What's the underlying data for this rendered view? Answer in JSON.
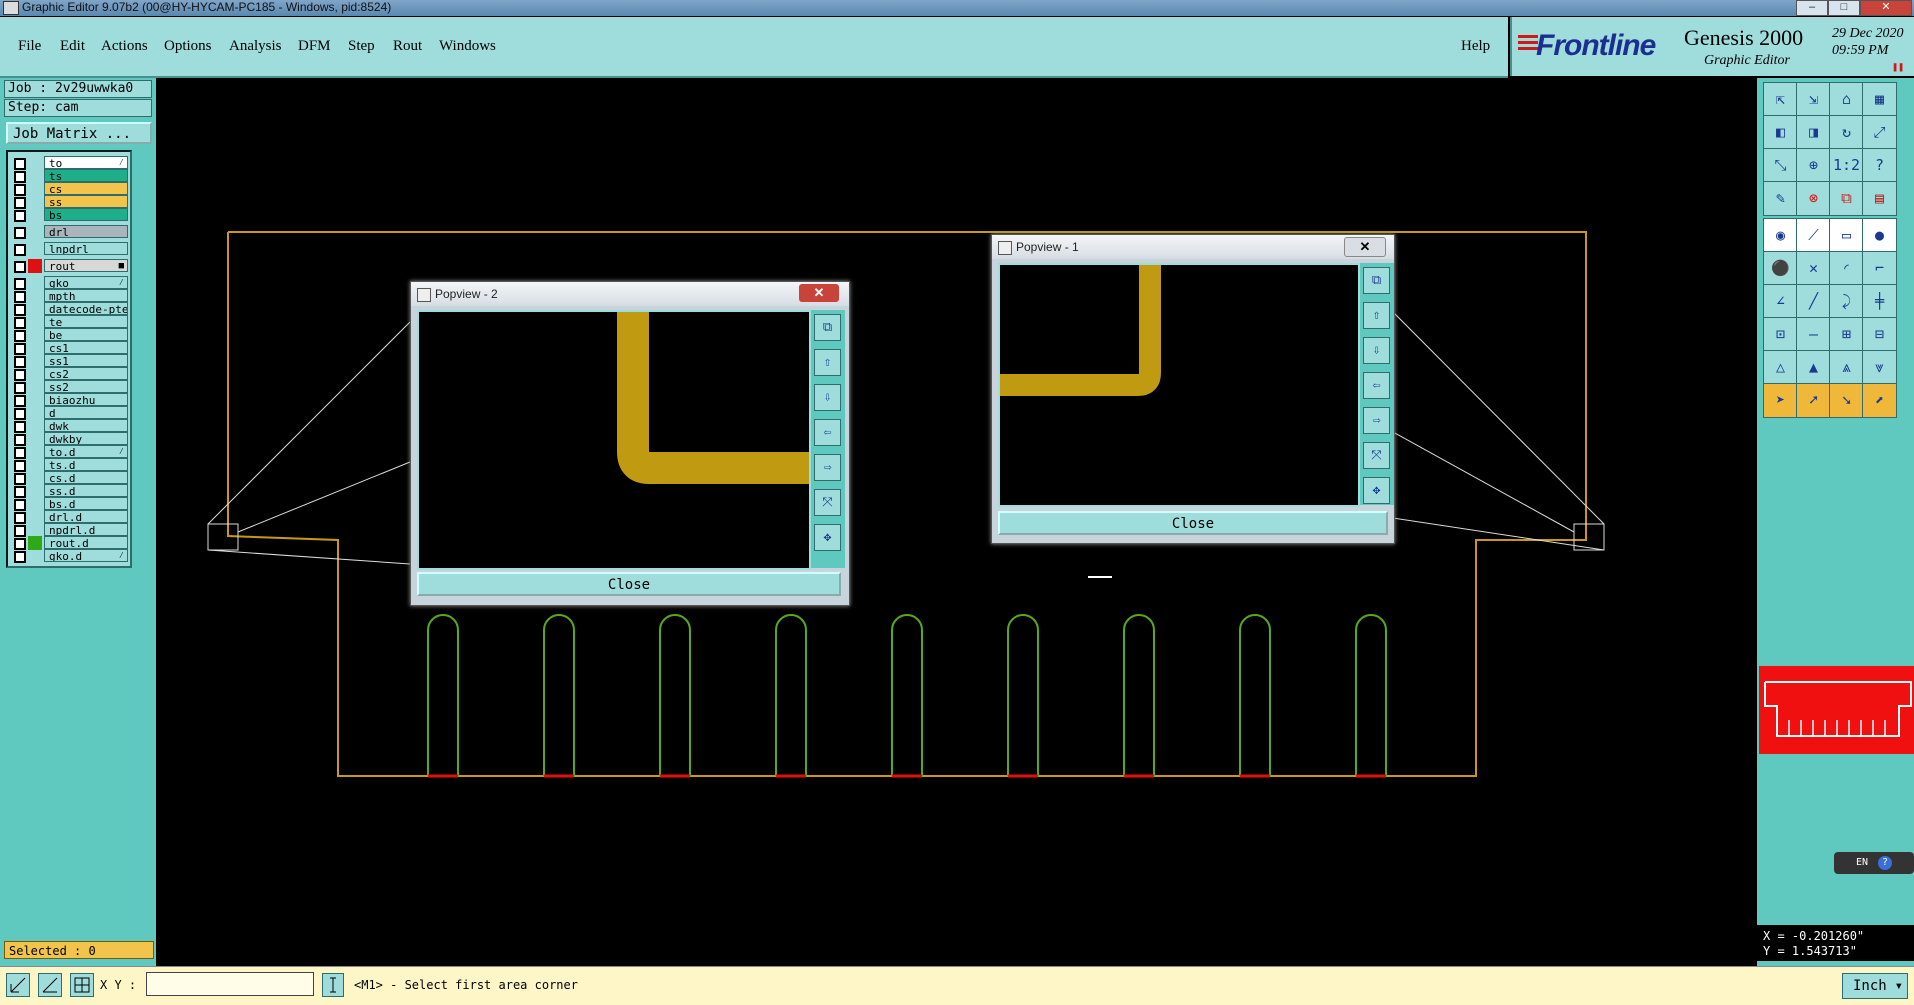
{
  "window": {
    "title": "Graphic Editor 9.07b2 (00@HY-HYCAM-PC185 - Windows, pid:8524)"
  },
  "menu": {
    "items": [
      "File",
      "Edit",
      "Actions",
      "Options",
      "Analysis",
      "DFM",
      "Step",
      "Rout",
      "Windows"
    ],
    "help": "Help"
  },
  "brand": {
    "logo": "Frontline",
    "product": "Genesis 2000",
    "subtitle": "Graphic Editor",
    "date": "29 Dec 2020",
    "time": "09:59 PM"
  },
  "job": {
    "job_label": "Job : 2v29uwwka0",
    "step_label": "Step: cam",
    "matrix_button": "Job Matrix ..."
  },
  "layers": [
    {
      "name": "to",
      "color": "#ffffff",
      "swatch": "",
      "marker": "⁄"
    },
    {
      "name": "ts",
      "color": "#1fae8a",
      "swatch": "",
      "marker": ""
    },
    {
      "name": "cs",
      "color": "#f3c44b",
      "swatch": "",
      "marker": ""
    },
    {
      "name": "ss",
      "color": "#f3c44b",
      "swatch": "",
      "marker": ""
    },
    {
      "name": "bs",
      "color": "#1fae8a",
      "swatch": "",
      "marker": ""
    },
    {
      "name": "drl",
      "color": "#aab4bb",
      "swatch": "",
      "marker": ""
    },
    {
      "name": "lnpdrl",
      "color": "#9fdcdc",
      "swatch": "",
      "marker": ""
    },
    {
      "name": "rout",
      "color": "#d8d8d8",
      "swatch": "#e01010",
      "marker": "■"
    },
    {
      "name": "gko",
      "color": "#9fdcdc",
      "swatch": "",
      "marker": "⁄"
    },
    {
      "name": "mpth",
      "color": "#9fdcdc",
      "swatch": "",
      "marker": ""
    },
    {
      "name": "datecode-pte",
      "color": "#9fdcdc",
      "swatch": "",
      "marker": ""
    },
    {
      "name": "te",
      "color": "#9fdcdc",
      "swatch": "",
      "marker": ""
    },
    {
      "name": "be",
      "color": "#9fdcdc",
      "swatch": "",
      "marker": ""
    },
    {
      "name": "cs1",
      "color": "#9fdcdc",
      "swatch": "",
      "marker": ""
    },
    {
      "name": "ss1",
      "color": "#9fdcdc",
      "swatch": "",
      "marker": ""
    },
    {
      "name": "cs2",
      "color": "#9fdcdc",
      "swatch": "",
      "marker": ""
    },
    {
      "name": "ss2",
      "color": "#9fdcdc",
      "swatch": "",
      "marker": ""
    },
    {
      "name": "biaozhu",
      "color": "#9fdcdc",
      "swatch": "",
      "marker": ""
    },
    {
      "name": "d",
      "color": "#9fdcdc",
      "swatch": "",
      "marker": ""
    },
    {
      "name": "dwk",
      "color": "#9fdcdc",
      "swatch": "",
      "marker": ""
    },
    {
      "name": "dwkby",
      "color": "#9fdcdc",
      "swatch": "",
      "marker": ""
    },
    {
      "name": "to.d",
      "color": "#9fdcdc",
      "swatch": "",
      "marker": "⁄"
    },
    {
      "name": "ts.d",
      "color": "#9fdcdc",
      "swatch": "",
      "marker": ""
    },
    {
      "name": "cs.d",
      "color": "#9fdcdc",
      "swatch": "",
      "marker": ""
    },
    {
      "name": "ss.d",
      "color": "#9fdcdc",
      "swatch": "",
      "marker": ""
    },
    {
      "name": "bs.d",
      "color": "#9fdcdc",
      "swatch": "",
      "marker": ""
    },
    {
      "name": "drl.d",
      "color": "#9fdcdc",
      "swatch": "",
      "marker": ""
    },
    {
      "name": "npdrl.d",
      "color": "#9fdcdc",
      "swatch": "",
      "marker": ""
    },
    {
      "name": "rout.d",
      "color": "#9fdcdc",
      "swatch": "#2fa81a",
      "marker": ""
    },
    {
      "name": "gko.d",
      "color": "#9fdcdc",
      "swatch": "",
      "marker": "⁄"
    }
  ],
  "status": {
    "selected": "Selected : 0",
    "xy_label": "X Y :",
    "xy_value": "",
    "prompt": "<M1> - Select first area corner",
    "units": "Inch"
  },
  "coordinates": {
    "x": "X = -0.201260\"",
    "y": "Y = 1.543713\""
  },
  "popview2": {
    "title": "Popview - 2",
    "close": "Close"
  },
  "popview1": {
    "title": "Popview - 1",
    "close": "Close"
  },
  "lang_bar": "EN",
  "colors": {
    "panel_teal": "#5fc9c0",
    "button_teal": "#9fdcdc",
    "outline_gold": "#c99a10",
    "rout_green": "#5aa81a",
    "copper": "#c09a10",
    "highlight_red": "#e01010"
  },
  "icons": {
    "right_toolbar": [
      "zoom-home-icon",
      "zoom-out-icon",
      "home-icon",
      "window-icon",
      "pan-left-icon",
      "pan-right-icon",
      "redraw-icon",
      "fit-icon",
      "zoom-fit-icon",
      "zoom-in-icon",
      "scale-1-2-icon",
      "help-icon",
      "measure-icon",
      "snap-icon",
      "layers-icon",
      "grid-icon",
      "pad-icon",
      "line-icon",
      "ruler-icon",
      "dot-icon",
      "node-icon",
      "cross-icon",
      "arc-icon",
      "corner-icon",
      "angle-icon",
      "diag-icon",
      "curve-icon",
      "split-icon",
      "attr-icon",
      "minus-icon",
      "align-icon",
      "copy-icon",
      "tri-icon",
      "tri2-icon",
      "tri3-icon",
      "tri4-icon",
      "pointer-icon",
      "pointer2-icon",
      "pointer3-icon",
      "pointer4-icon"
    ]
  }
}
